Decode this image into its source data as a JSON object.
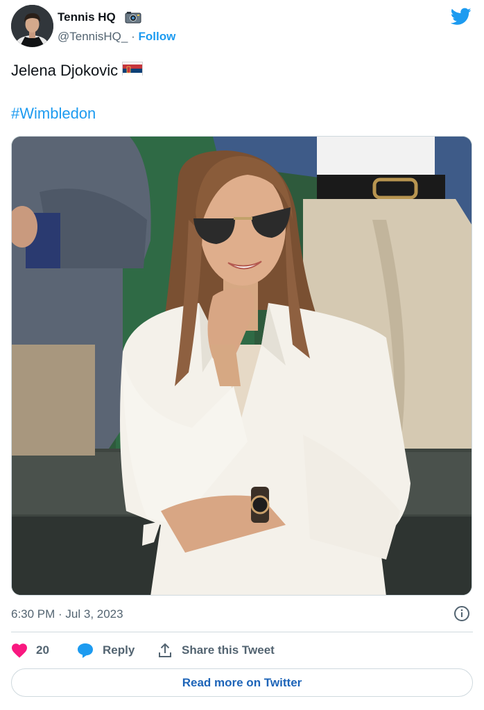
{
  "author": {
    "name": "Tennis HQ",
    "handle": "@TennisHQ_",
    "separator": "·",
    "follow_label": "Follow",
    "name_emoji_icon": "camera-icon"
  },
  "tweet": {
    "text": "Jelena Djokovic",
    "flag_icon": "serbia-flag-icon",
    "hashtag": "#Wimbledon",
    "timestamp": "6:30 PM · Jul 3, 2023"
  },
  "actions": {
    "like_count": "20",
    "reply_label": "Reply",
    "share_label": "Share this Tweet"
  },
  "footer": {
    "read_more_label": "Read more on Twitter"
  },
  "colors": {
    "brand_blue": "#1d9bf0",
    "like_red": "#f91880",
    "muted_text": "#536471",
    "border": "#cfd9de"
  }
}
